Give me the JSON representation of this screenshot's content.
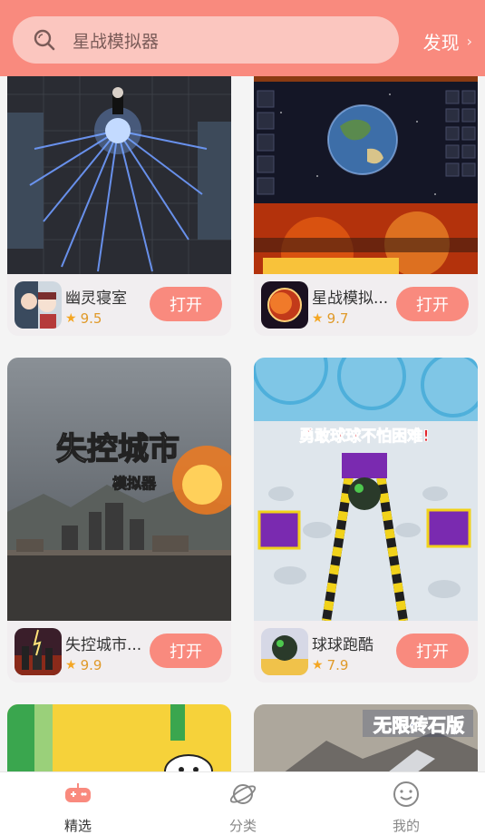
{
  "header": {
    "search_placeholder": "星战模拟器",
    "discover_label": "发现",
    "search_icon": "search-icon",
    "chevron_icon": "chevron-right-icon"
  },
  "colors": {
    "accent": "#f98a7e",
    "search_bg": "#fbc6bf",
    "card_bg": "#f1eef0",
    "rating": "#e09a2a"
  },
  "games": [
    {
      "name": "幽灵寝室",
      "rating": "9.5",
      "action": "打开"
    },
    {
      "name": "星战模拟...",
      "rating": "9.7",
      "action": "打开"
    },
    {
      "name": "失控城市...",
      "rating": "9.9",
      "action": "打开"
    },
    {
      "name": "球球跑酷",
      "rating": "7.9",
      "action": "打开"
    }
  ],
  "art_text": {
    "city_title": "失控城市",
    "city_sub": "模拟器",
    "ball_banner": "勇敢球球不怕困难!",
    "brick_banner": "无限砖石版"
  },
  "tabs": [
    {
      "label": "精选",
      "icon": "gamepad-icon",
      "active": true
    },
    {
      "label": "分类",
      "icon": "planet-icon",
      "active": false
    },
    {
      "label": "我的",
      "icon": "smiley-icon",
      "active": false
    }
  ]
}
